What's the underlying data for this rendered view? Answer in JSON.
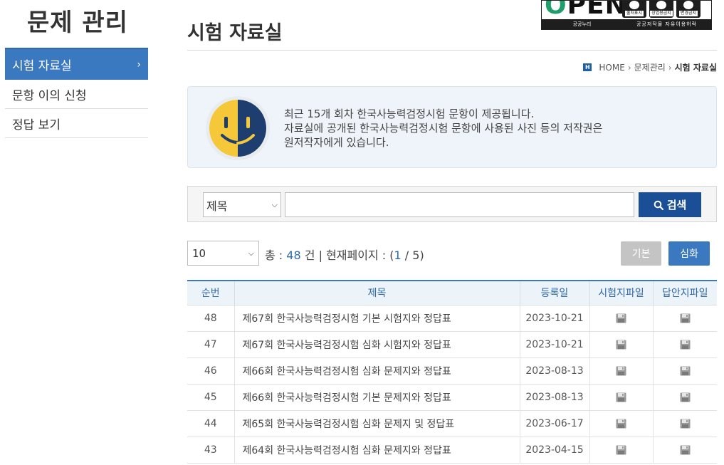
{
  "sidebar": {
    "title": "문제 관리",
    "items": [
      {
        "label": "시험 자료실",
        "active": true
      },
      {
        "label": "문항 이의 신청",
        "active": false
      },
      {
        "label": "정답 보기",
        "active": false
      }
    ]
  },
  "header": {
    "title": "시험 자료실",
    "open_badge": {
      "word": "OPEN",
      "left_caption": "공공누리",
      "right_caption": "공공저작물 자유이용허락",
      "icons": [
        "출처표시",
        "상업용금지",
        "변경금지"
      ]
    }
  },
  "breadcrumb": {
    "home_icon": "H",
    "items": [
      "HOME",
      "문제관리",
      "시험 자료실"
    ]
  },
  "notice": {
    "icon": "smiley-face-icon",
    "lines": [
      "최근 15개 회차 한국사능력검정시험 문항이 제공됩니다.",
      "자료실에 공개된 한국사능력검정시험 문항에 사용된 사진 등의 저작권은",
      "원저작자에게 있습니다."
    ]
  },
  "search": {
    "field_selected": "제목",
    "query_value": "",
    "button_label": "검색"
  },
  "toolbar": {
    "page_size_selected": "10",
    "total_label": "총 :",
    "total_count": "48",
    "count_unit": "건",
    "divider": "|",
    "page_label": "현재페이지 :",
    "current_page": "1",
    "total_pages": "5",
    "basic_button": "기본",
    "advanced_button": "심화"
  },
  "table": {
    "headers": [
      "순번",
      "제목",
      "등록일",
      "시험지파일",
      "답안지파일"
    ],
    "rows": [
      {
        "no": "48",
        "title": "제67회 한국사능력검정시험 기본 시험지와 정답표",
        "date": "2023-10-21"
      },
      {
        "no": "47",
        "title": "제67회 한국사능력검정시험 심화 시험지와 정답표",
        "date": "2023-10-21"
      },
      {
        "no": "46",
        "title": "제66회 한국사능력검정시험 심화 문제지와 정답표",
        "date": "2023-08-13"
      },
      {
        "no": "45",
        "title": "제66회 한국사능력검정시험 기본 문제지와 정답표",
        "date": "2023-08-13"
      },
      {
        "no": "44",
        "title": "제65회 한국사능력검정시험 심화 문제지 및 정답표",
        "date": "2023-06-17"
      },
      {
        "no": "43",
        "title": "제64회 한국사능력검정시험 심화 문제지와 정답표",
        "date": "2023-04-15"
      }
    ]
  },
  "colors": {
    "primary": "#3a78bf",
    "search_button": "#1a4f97",
    "notice_bg": "#eef4f9",
    "face_yellow": "#f5c83a",
    "face_navy": "#1d3e6e"
  }
}
